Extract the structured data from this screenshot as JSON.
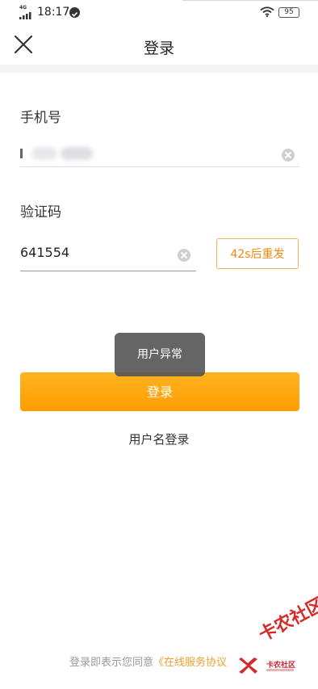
{
  "status_bar": {
    "network": "4G",
    "time": "18:17",
    "battery": "95"
  },
  "nav": {
    "title": "登录",
    "close_icon": "close-icon"
  },
  "form": {
    "phone_label": "手机号",
    "code_label": "验证码",
    "code_value": "641554",
    "resend_label": "42s后重发"
  },
  "toast": {
    "message": "用户异常"
  },
  "actions": {
    "login_label": "登录",
    "username_login_label": "用户名登录"
  },
  "agreement": {
    "prefix": "登录即表示您同意",
    "link": "《在线服务协议"
  },
  "watermark": {
    "text": "卡农社区",
    "small_text": "卡农社区"
  },
  "colors": {
    "accent": "#ff9d00",
    "resend_border": "#f5b15a",
    "resend_text": "#f08a14",
    "link": "#f0a030"
  }
}
